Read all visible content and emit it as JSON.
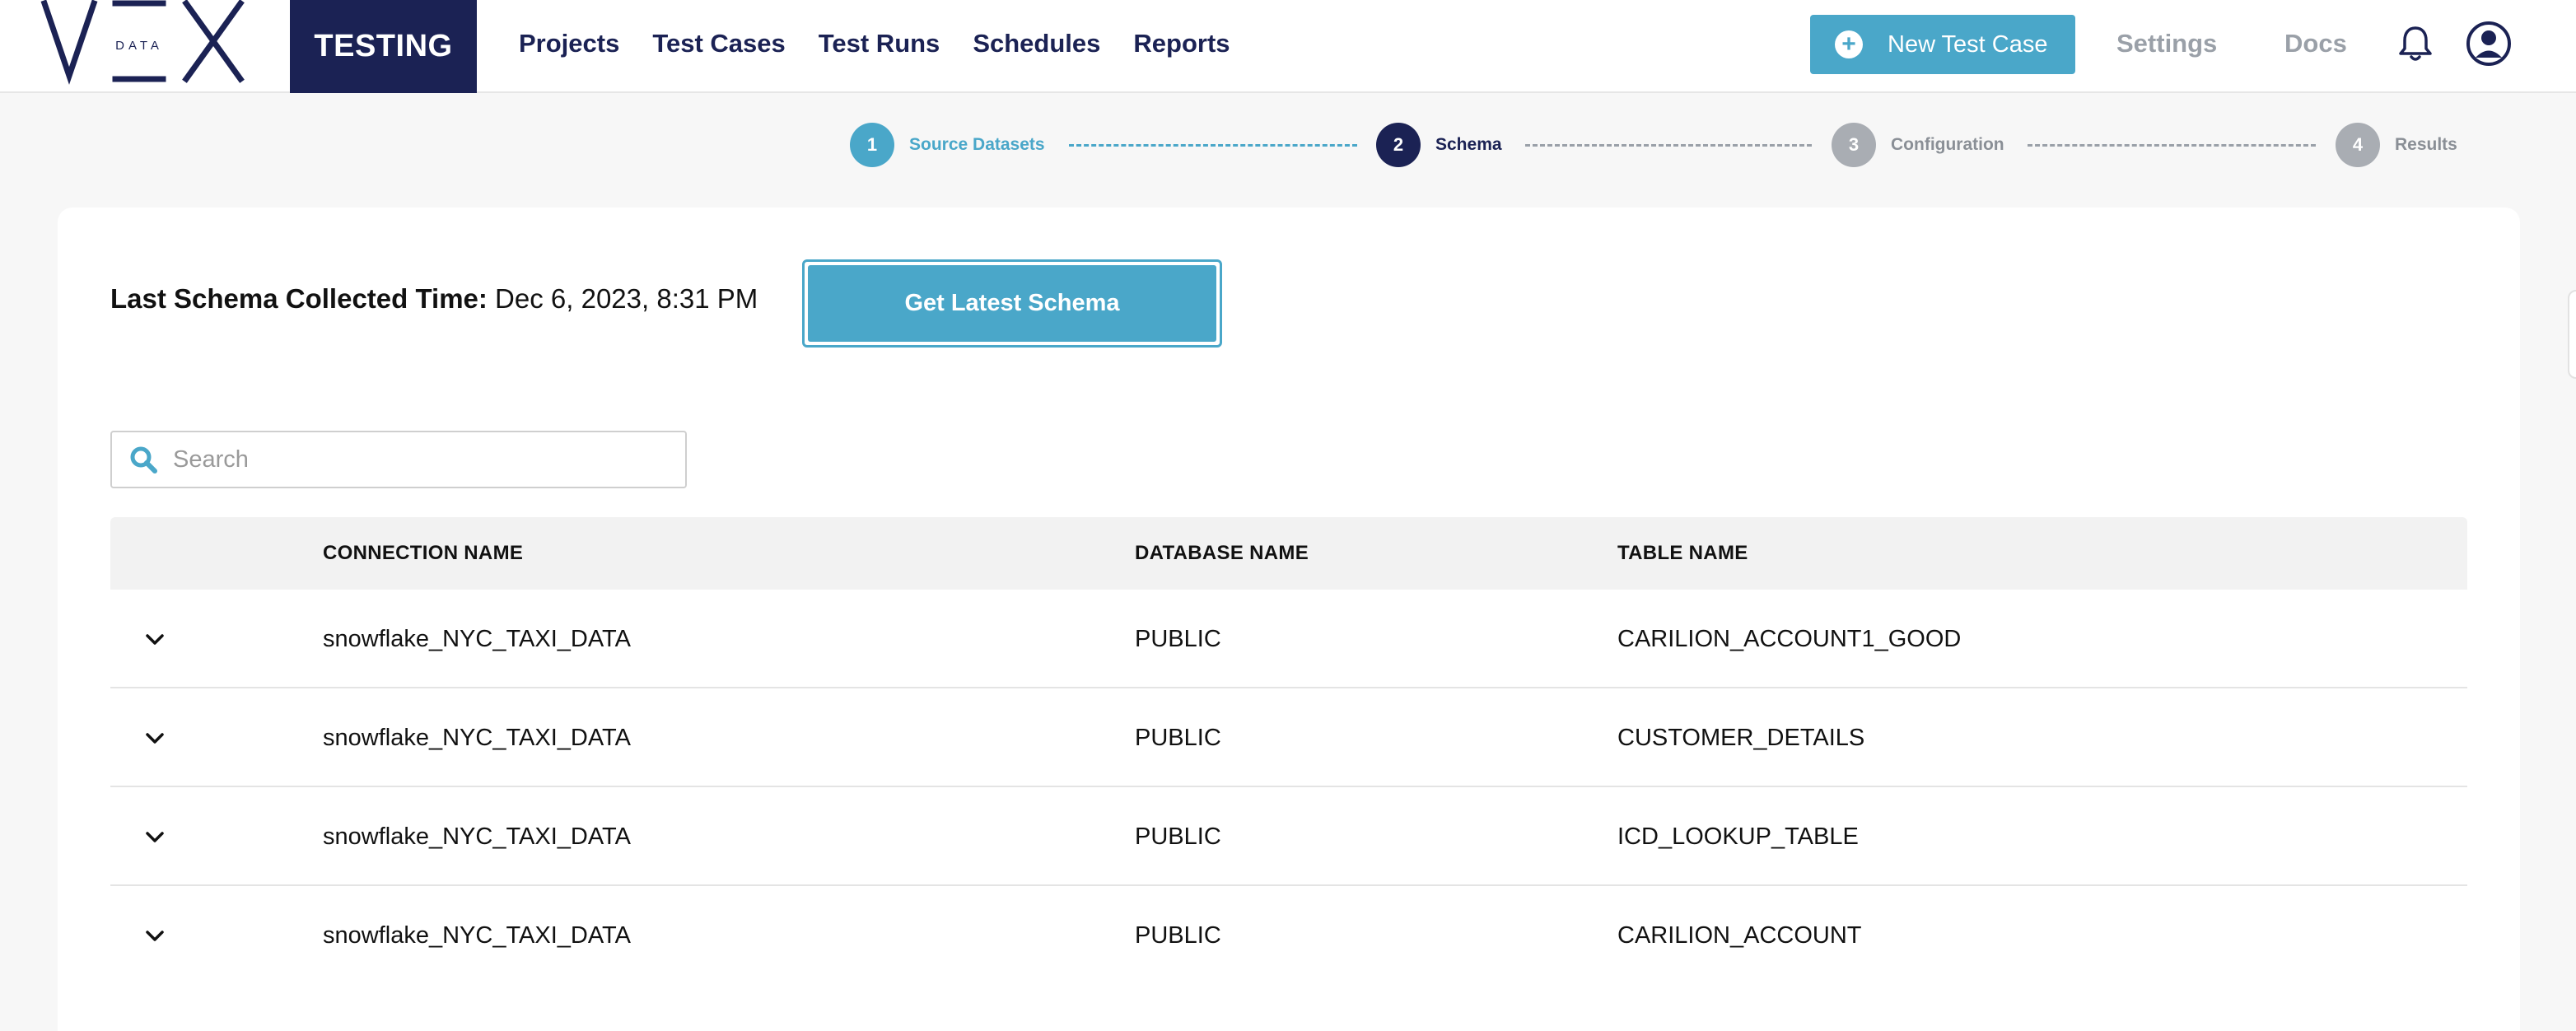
{
  "logo": {
    "main": "VEX",
    "sub": "DATA"
  },
  "nav": {
    "brand": "TESTING",
    "links": [
      "Projects",
      "Test Cases",
      "Test Runs",
      "Schedules",
      "Reports"
    ],
    "new_button": "New Test Case",
    "settings": "Settings",
    "docs": "Docs"
  },
  "stepper": [
    {
      "number": "1",
      "label": "Source Datasets",
      "state": "completed",
      "color": "#4aa7c9"
    },
    {
      "number": "2",
      "label": "Schema",
      "state": "active",
      "color": "#1b2254"
    },
    {
      "number": "3",
      "label": "Configuration",
      "state": "pending",
      "color": "#a9adb3"
    },
    {
      "number": "4",
      "label": "Results",
      "state": "pending",
      "color": "#a9adb3"
    }
  ],
  "schema": {
    "label": "Last Schema Collected Time:",
    "value": "Dec 6, 2023, 8:31 PM",
    "button": "Get Latest Schema"
  },
  "search": {
    "placeholder": "Search",
    "value": ""
  },
  "table": {
    "columns": [
      "CONNECTION NAME",
      "DATABASE NAME",
      "TABLE NAME"
    ],
    "rows": [
      [
        "snowflake_NYC_TAXI_DATA",
        "PUBLIC",
        "CARILION_ACCOUNT1_GOOD"
      ],
      [
        "snowflake_NYC_TAXI_DATA",
        "PUBLIC",
        "CUSTOMER_DETAILS"
      ],
      [
        "snowflake_NYC_TAXI_DATA",
        "PUBLIC",
        "ICD_LOOKUP_TABLE"
      ],
      [
        "snowflake_NYC_TAXI_DATA",
        "PUBLIC",
        "CARILION_ACCOUNT"
      ]
    ]
  },
  "colors": {
    "navy": "#1b2254",
    "accent": "#4aa7c9",
    "muted": "#9aa0a8"
  },
  "icons": {
    "bell": "bell-icon",
    "user": "user-avatar-icon",
    "search": "search-icon",
    "expand": "chevron-down-icon",
    "add": "plus-circle-icon"
  }
}
